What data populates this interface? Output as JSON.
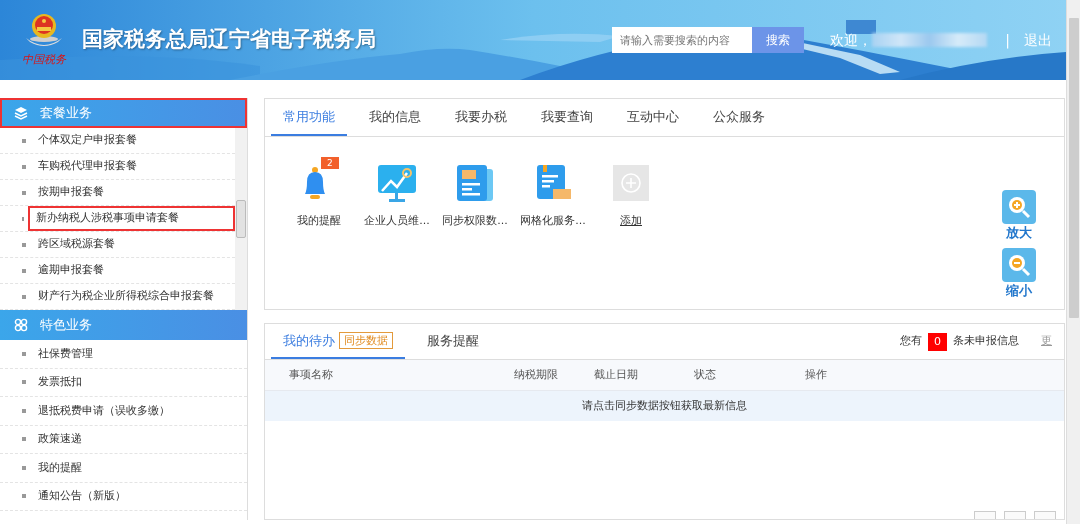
{
  "header": {
    "title": "国家税务总局辽宁省电子税务局",
    "emblem_caption": "中国税务",
    "search": {
      "placeholder": "请输入需要搜索的内容",
      "button": "搜索"
    },
    "welcome": "欢迎，",
    "separator": "|",
    "logout": "退出"
  },
  "sidebar": {
    "sections": [
      {
        "title": "套餐业务",
        "kind": "package",
        "highlighted": true,
        "items": [
          {
            "label": "个体双定户申报套餐",
            "highlighted": false
          },
          {
            "label": "车购税代理申报套餐",
            "highlighted": false
          },
          {
            "label": "按期申报套餐",
            "highlighted": false
          },
          {
            "label": "新办纳税人涉税事项申请套餐",
            "highlighted": true
          },
          {
            "label": "跨区域税源套餐",
            "highlighted": false
          },
          {
            "label": "逾期申报套餐",
            "highlighted": false
          },
          {
            "label": "财产行为税企业所得税综合申报套餐",
            "highlighted": false
          }
        ]
      },
      {
        "title": "特色业务",
        "kind": "featured",
        "highlighted": false,
        "items": [
          {
            "label": "社保费管理",
            "highlighted": false
          },
          {
            "label": "发票抵扣",
            "highlighted": false
          },
          {
            "label": "退抵税费申请（误收多缴）",
            "highlighted": false
          },
          {
            "label": "政策速递",
            "highlighted": false
          },
          {
            "label": "我的提醒",
            "highlighted": false
          },
          {
            "label": "通知公告（新版）",
            "highlighted": false
          }
        ]
      }
    ]
  },
  "tabs": [
    {
      "label": "常用功能",
      "selected": true
    },
    {
      "label": "我的信息",
      "selected": false
    },
    {
      "label": "我要办税",
      "selected": false
    },
    {
      "label": "我要查询",
      "selected": false
    },
    {
      "label": "互动中心",
      "selected": false
    },
    {
      "label": "公众服务",
      "selected": false
    }
  ],
  "shortcuts": [
    {
      "kind": "bell",
      "label": "我的提醒",
      "badge": "2"
    },
    {
      "kind": "chart",
      "label": "企业人员维..."
    },
    {
      "kind": "newspaper",
      "label": "同步权限数..."
    },
    {
      "kind": "document",
      "label": "网格化服务..."
    },
    {
      "kind": "add",
      "label": "添加"
    }
  ],
  "todo": {
    "tabs": [
      {
        "label": "我的待办",
        "selected": true,
        "tag": "同步数据"
      },
      {
        "label": "服务提醒",
        "selected": false
      }
    ],
    "notice": {
      "prefix": "您有",
      "count": "0",
      "suffix": "条未申报信息",
      "more": "更"
    },
    "columns": [
      "事项名称",
      "纳税期限",
      "截止日期",
      "状态",
      "操作"
    ],
    "empty_message": "请点击同步数据按钮获取最新信息"
  },
  "zoom_controls": [
    {
      "kind": "zoom-in",
      "label": "放大"
    },
    {
      "kind": "zoom-out",
      "label": "缩小"
    }
  ]
}
